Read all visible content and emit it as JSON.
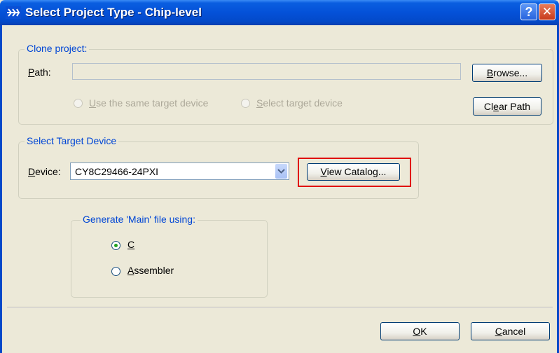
{
  "window": {
    "title": "Select Project Type - Chip-level",
    "help_button": "?",
    "close_button": "✕"
  },
  "clone_project": {
    "title": "Clone project:",
    "path_label": "Path:",
    "path_value": "",
    "browse_button": "Browse...",
    "clear_path_button": "Clear Path",
    "option_same_device": "Use the same target device",
    "option_select_device": "Select target device"
  },
  "target_device": {
    "title": "Select Target Device",
    "device_label": "Device:",
    "device_value": "CY8C29466-24PXI",
    "view_catalog_button": "View Catalog..."
  },
  "generate_main": {
    "title": "Generate 'Main' file using:",
    "options": [
      {
        "label": "C",
        "selected": true
      },
      {
        "label": "Assembler",
        "selected": false
      }
    ]
  },
  "footer": {
    "ok_button": "OK",
    "cancel_button": "Cancel"
  },
  "colors": {
    "titlebar": "#0451d8",
    "group_title": "#0046d5",
    "highlight": "#e00000",
    "background": "#ece9d8"
  }
}
